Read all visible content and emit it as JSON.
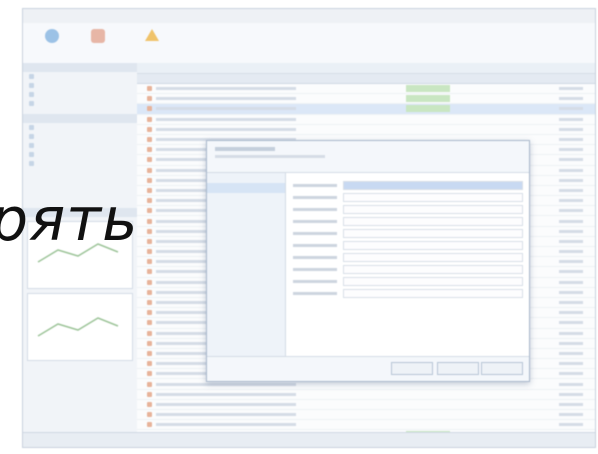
{
  "overlay": {
    "text": "рять"
  },
  "colors": {
    "overlay_text": "#111111",
    "selection": "#dbe7f7",
    "status_green": "#c9e6c2",
    "accent_blue": "#c8d9f2"
  },
  "icons": [
    "globe-icon",
    "tools-icon",
    "warning-icon",
    "document-icon",
    "folder-icon"
  ]
}
